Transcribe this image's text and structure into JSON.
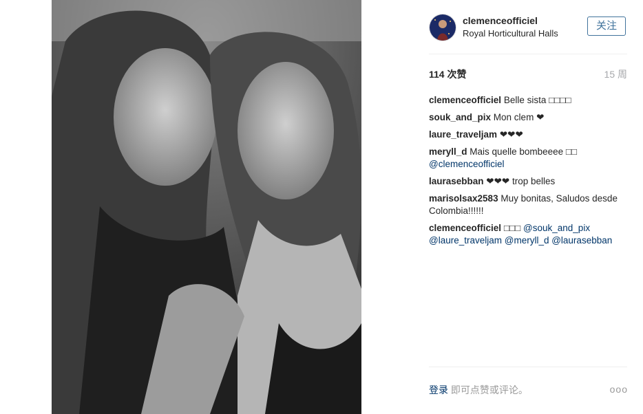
{
  "post": {
    "owner": "clemenceofficiel",
    "location": "Royal Horticultural Halls",
    "follow_label": "关注",
    "likes": "114 次赞",
    "age": "15 周"
  },
  "comments": [
    {
      "author": "clemenceofficiel",
      "text": "Belle sista □□□□",
      "mention": ""
    },
    {
      "author": "souk_and_pix",
      "text": "Mon clem ❤",
      "mention": ""
    },
    {
      "author": "laure_traveljam",
      "text": "❤❤❤",
      "mention": ""
    },
    {
      "author": "meryll_d",
      "text": "Mais quelle bombeeee □□",
      "mention": "@clemenceofficiel"
    },
    {
      "author": "laurasebban",
      "text": "❤❤❤ trop belles",
      "mention": ""
    },
    {
      "author": "marisolsax2583",
      "text": "Muy bonitas, Saludos desde Colombia!!!!!!",
      "mention": ""
    },
    {
      "author": "clemenceofficiel",
      "text": "□□□",
      "mention": "@souk_and_pix @laure_traveljam @meryll_d @laurasebban"
    }
  ],
  "footer": {
    "login_label": "登录",
    "login_suffix": " 即可点赞或评论。",
    "more_icon": "ooo"
  },
  "icons": {
    "more": "more-options-icon"
  }
}
